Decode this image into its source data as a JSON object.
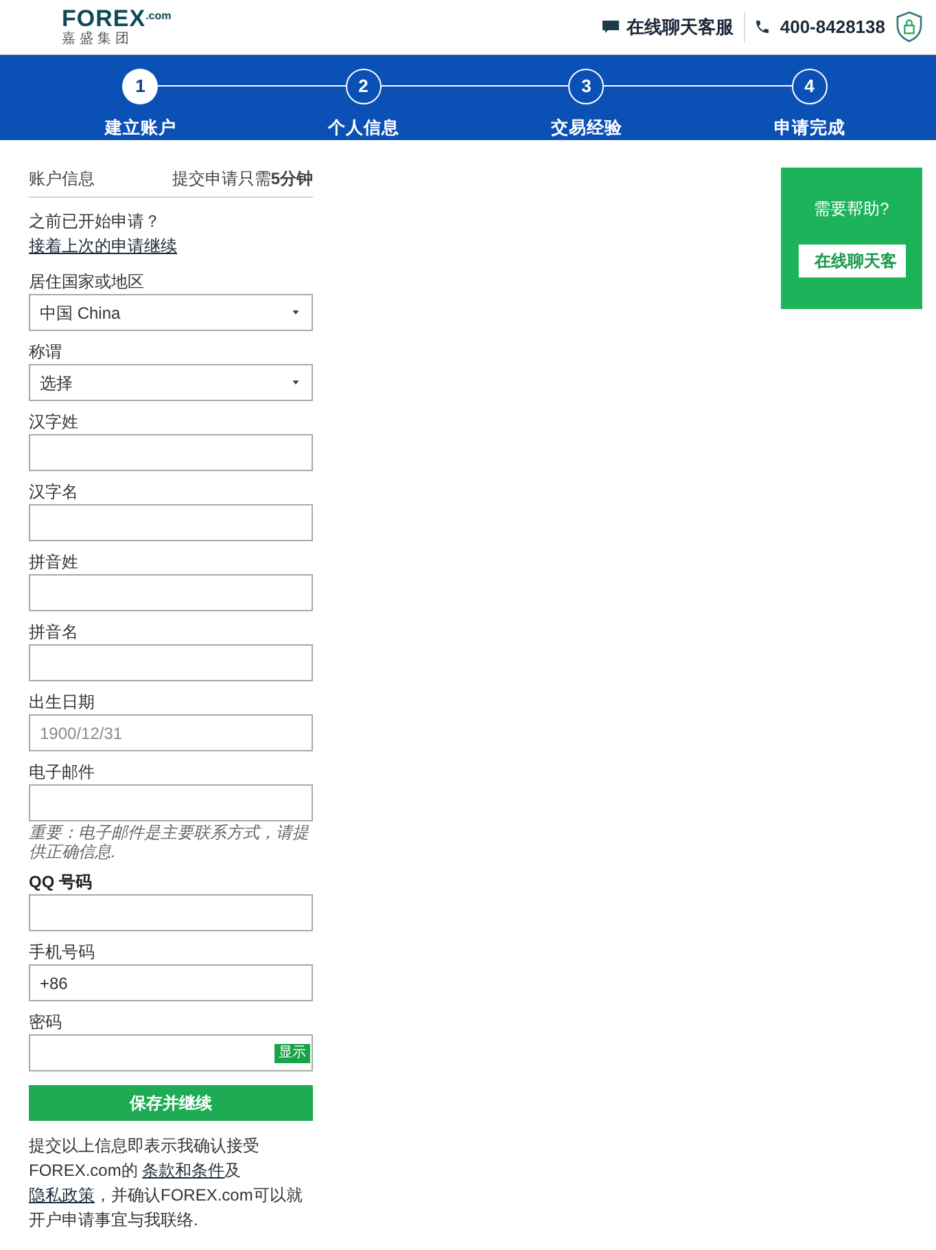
{
  "header": {
    "logo": {
      "wordmark": "FOREX",
      "suffix": ".com",
      "subtitle": "嘉盛集团"
    },
    "chat_link": "在线聊天客服",
    "phone": "400-8428138"
  },
  "steps": [
    {
      "number": "1",
      "label": "建立账户",
      "selected": true
    },
    {
      "number": "2",
      "label": "个人信息",
      "selected": false
    },
    {
      "number": "3",
      "label": "交易经验",
      "selected": false
    },
    {
      "number": "4",
      "label": "申请完成",
      "selected": false
    }
  ],
  "form": {
    "section_title": "账户信息",
    "duration_note": "提交申请只需**5分钟**",
    "resume": [
      {
        "kind": "text",
        "text": "之前已开始申请？ "
      },
      {
        "kind": "link",
        "text": "接着上次的申请继续"
      }
    ],
    "fields": [
      {
        "kind": "select",
        "label": "居住国家或地区",
        "label_bold": false,
        "value": "中国 China"
      },
      {
        "kind": "select",
        "label": "称谓",
        "label_bold": false,
        "value": "选择"
      },
      {
        "kind": "text",
        "label": "汉字姓",
        "label_bold": false
      },
      {
        "kind": "text",
        "label": "汉字名",
        "label_bold": false
      },
      {
        "kind": "text",
        "label": "拼音姓",
        "label_bold": false
      },
      {
        "kind": "text",
        "label": "拼音名",
        "label_bold": false
      },
      {
        "kind": "text",
        "label": "出生日期",
        "label_bold": false,
        "placeholder": "1900/12/31"
      },
      {
        "kind": "text",
        "label": "电子邮件",
        "label_bold": false,
        "note": "重要：电子邮件是主要联系方式，请提供正确信息."
      },
      {
        "kind": "text",
        "label": "QQ 号码",
        "label_bold": true
      },
      {
        "kind": "text",
        "label": "手机号码",
        "label_bold": false,
        "value": "+86"
      },
      {
        "kind": "password",
        "label": "密码",
        "label_bold": false,
        "toggle": "显示"
      }
    ],
    "submit": "保存并继续",
    "consent": [
      {
        "kind": "text",
        "text": "提交以上信息即表示我确认接受FOREX.com的 "
      },
      {
        "kind": "link",
        "text": "条款和条件"
      },
      {
        "kind": "text",
        "text": "及 "
      },
      {
        "kind": "link",
        "text": "隐私政策"
      },
      {
        "kind": "text",
        "text": "，并确认FOREX.com可以就开户申请事宜与我联络."
      }
    ]
  },
  "help": {
    "title": "需要帮助?",
    "button": "在线聊天客"
  }
}
